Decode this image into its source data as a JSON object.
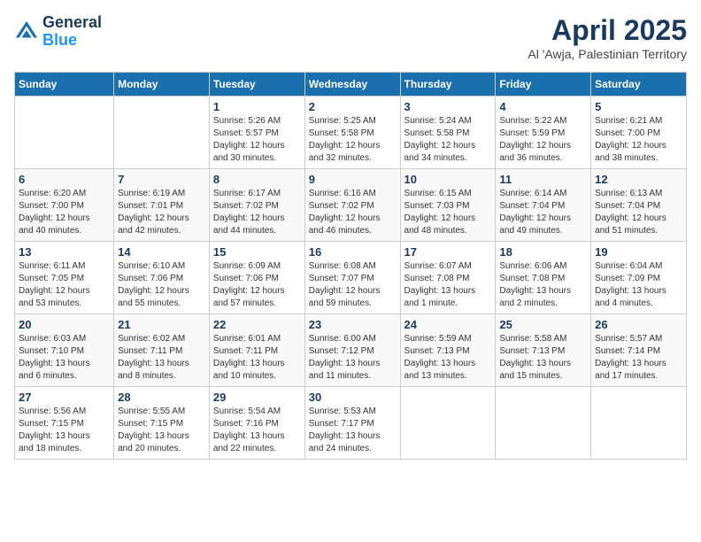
{
  "header": {
    "logo_line1": "General",
    "logo_line2": "Blue",
    "title": "April 2025",
    "subtitle": "Al 'Awja, Palestinian Territory"
  },
  "days_of_week": [
    "Sunday",
    "Monday",
    "Tuesday",
    "Wednesday",
    "Thursday",
    "Friday",
    "Saturday"
  ],
  "weeks": [
    [
      {
        "day": "",
        "info": ""
      },
      {
        "day": "",
        "info": ""
      },
      {
        "day": "1",
        "info": "Sunrise: 5:26 AM\nSunset: 5:57 PM\nDaylight: 12 hours\nand 30 minutes."
      },
      {
        "day": "2",
        "info": "Sunrise: 5:25 AM\nSunset: 5:58 PM\nDaylight: 12 hours\nand 32 minutes."
      },
      {
        "day": "3",
        "info": "Sunrise: 5:24 AM\nSunset: 5:58 PM\nDaylight: 12 hours\nand 34 minutes."
      },
      {
        "day": "4",
        "info": "Sunrise: 5:22 AM\nSunset: 5:59 PM\nDaylight: 12 hours\nand 36 minutes."
      },
      {
        "day": "5",
        "info": "Sunrise: 6:21 AM\nSunset: 7:00 PM\nDaylight: 12 hours\nand 38 minutes."
      }
    ],
    [
      {
        "day": "6",
        "info": "Sunrise: 6:20 AM\nSunset: 7:00 PM\nDaylight: 12 hours\nand 40 minutes."
      },
      {
        "day": "7",
        "info": "Sunrise: 6:19 AM\nSunset: 7:01 PM\nDaylight: 12 hours\nand 42 minutes."
      },
      {
        "day": "8",
        "info": "Sunrise: 6:17 AM\nSunset: 7:02 PM\nDaylight: 12 hours\nand 44 minutes."
      },
      {
        "day": "9",
        "info": "Sunrise: 6:16 AM\nSunset: 7:02 PM\nDaylight: 12 hours\nand 46 minutes."
      },
      {
        "day": "10",
        "info": "Sunrise: 6:15 AM\nSunset: 7:03 PM\nDaylight: 12 hours\nand 48 minutes."
      },
      {
        "day": "11",
        "info": "Sunrise: 6:14 AM\nSunset: 7:04 PM\nDaylight: 12 hours\nand 49 minutes."
      },
      {
        "day": "12",
        "info": "Sunrise: 6:13 AM\nSunset: 7:04 PM\nDaylight: 12 hours\nand 51 minutes."
      }
    ],
    [
      {
        "day": "13",
        "info": "Sunrise: 6:11 AM\nSunset: 7:05 PM\nDaylight: 12 hours\nand 53 minutes."
      },
      {
        "day": "14",
        "info": "Sunrise: 6:10 AM\nSunset: 7:06 PM\nDaylight: 12 hours\nand 55 minutes."
      },
      {
        "day": "15",
        "info": "Sunrise: 6:09 AM\nSunset: 7:06 PM\nDaylight: 12 hours\nand 57 minutes."
      },
      {
        "day": "16",
        "info": "Sunrise: 6:08 AM\nSunset: 7:07 PM\nDaylight: 12 hours\nand 59 minutes."
      },
      {
        "day": "17",
        "info": "Sunrise: 6:07 AM\nSunset: 7:08 PM\nDaylight: 13 hours\nand 1 minute."
      },
      {
        "day": "18",
        "info": "Sunrise: 6:06 AM\nSunset: 7:08 PM\nDaylight: 13 hours\nand 2 minutes."
      },
      {
        "day": "19",
        "info": "Sunrise: 6:04 AM\nSunset: 7:09 PM\nDaylight: 13 hours\nand 4 minutes."
      }
    ],
    [
      {
        "day": "20",
        "info": "Sunrise: 6:03 AM\nSunset: 7:10 PM\nDaylight: 13 hours\nand 6 minutes."
      },
      {
        "day": "21",
        "info": "Sunrise: 6:02 AM\nSunset: 7:11 PM\nDaylight: 13 hours\nand 8 minutes."
      },
      {
        "day": "22",
        "info": "Sunrise: 6:01 AM\nSunset: 7:11 PM\nDaylight: 13 hours\nand 10 minutes."
      },
      {
        "day": "23",
        "info": "Sunrise: 6:00 AM\nSunset: 7:12 PM\nDaylight: 13 hours\nand 11 minutes."
      },
      {
        "day": "24",
        "info": "Sunrise: 5:59 AM\nSunset: 7:13 PM\nDaylight: 13 hours\nand 13 minutes."
      },
      {
        "day": "25",
        "info": "Sunrise: 5:58 AM\nSunset: 7:13 PM\nDaylight: 13 hours\nand 15 minutes."
      },
      {
        "day": "26",
        "info": "Sunrise: 5:57 AM\nSunset: 7:14 PM\nDaylight: 13 hours\nand 17 minutes."
      }
    ],
    [
      {
        "day": "27",
        "info": "Sunrise: 5:56 AM\nSunset: 7:15 PM\nDaylight: 13 hours\nand 18 minutes."
      },
      {
        "day": "28",
        "info": "Sunrise: 5:55 AM\nSunset: 7:15 PM\nDaylight: 13 hours\nand 20 minutes."
      },
      {
        "day": "29",
        "info": "Sunrise: 5:54 AM\nSunset: 7:16 PM\nDaylight: 13 hours\nand 22 minutes."
      },
      {
        "day": "30",
        "info": "Sunrise: 5:53 AM\nSunset: 7:17 PM\nDaylight: 13 hours\nand 24 minutes."
      },
      {
        "day": "",
        "info": ""
      },
      {
        "day": "",
        "info": ""
      },
      {
        "day": "",
        "info": ""
      }
    ]
  ]
}
